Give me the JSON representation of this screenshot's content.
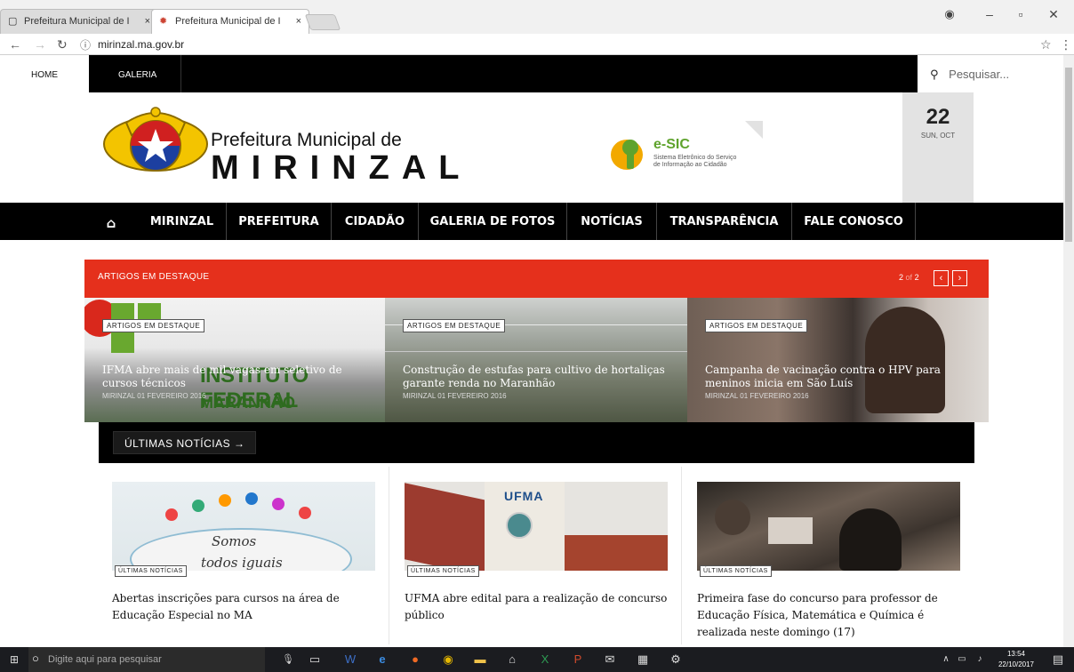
{
  "browser": {
    "tabs": [
      {
        "title": "Prefeitura Municipal de I",
        "close": "×"
      },
      {
        "title": "Prefeitura Municipal de I",
        "close": "×"
      }
    ],
    "url": "mirinzal.ma.gov.br"
  },
  "topbar": {
    "home": "HOME",
    "galeria": "GALERIA",
    "search_placeholder": "Pesquisar..."
  },
  "header": {
    "logo_line1": "Prefeitura Municipal de",
    "logo_line2": "MIRINZAL",
    "esic_title": "e-SIC",
    "esic_sub1": "Sistema Eletrônico do Serviço",
    "esic_sub2": "de Informação ao Cidadão",
    "date_day": "22",
    "date_sub": "SUN, OCT"
  },
  "mainnav": [
    "MIRINZAL",
    "PREFEITURA",
    "CIDADÃO",
    "GALERIA DE FOTOS",
    "NOTÍCIAS",
    "TRANSPARÊNCIA",
    "FALE CONOSCO"
  ],
  "featured": {
    "heading": "ARTIGOS EM DESTAQUE",
    "pager_current": "2",
    "pager_of": "of",
    "pager_total": "2",
    "slides": [
      {
        "label": "ARTIGOS EM DESTAQUE",
        "title": "IFMA abre mais de mil vagas em seletivo de cursos técnicos",
        "meta": "MIRINZAL   01 FEVEREIRO 2016",
        "overlay1": "INSTITUTO FEDERAL",
        "overlay2": "MARANHÃO"
      },
      {
        "label": "ARTIGOS EM DESTAQUE",
        "title": "Construção de estufas para cultivo de hortaliças garante renda no Maranhão",
        "meta": "MIRINZAL   01 FEVEREIRO 2016"
      },
      {
        "label": "ARTIGOS EM DESTAQUE",
        "title": "Campanha de vacinação contra o HPV para meninos inicia em São Luís",
        "meta": "MIRINZAL   01 FEVEREIRO 2016"
      }
    ]
  },
  "ultimas": {
    "heading": "ÚLTIMAS NOTÍCIAS →",
    "cards": [
      {
        "tag": "ÚLTIMAS NOTÍCIAS",
        "title": "Abertas inscrições para cursos na área de Educação Especial no MA",
        "img_text1": "Somos",
        "img_text2": "todos iguais"
      },
      {
        "tag": "ÚLTIMAS NOTÍCIAS",
        "title": "UFMA abre edital para a realização de concurso público",
        "img_text1": "UFMA"
      },
      {
        "tag": "ÚLTIMAS NOTÍCIAS",
        "title": "Primeira fase do concurso para professor de Educação Física, Matemática e Química é realizada neste domingo (17)"
      }
    ]
  },
  "taskbar": {
    "search_placeholder": "Digite aqui para pesquisar",
    "time": "13:54",
    "date": "22/10/2017"
  },
  "colors": {
    "accent_red": "#e5301c",
    "nav_black": "#000000"
  }
}
